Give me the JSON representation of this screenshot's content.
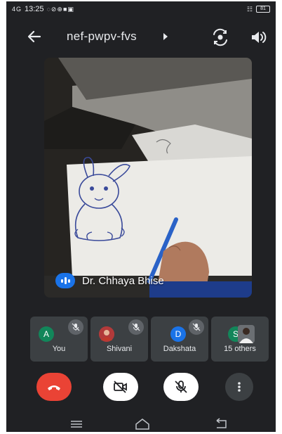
{
  "status_bar": {
    "network": "4G",
    "time": "13:25",
    "battery": "81"
  },
  "top_bar": {
    "meeting_code": "nef-pwpv-fvs"
  },
  "main_video": {
    "speaker_name": "Dr. Chhaya Bhise"
  },
  "participants": [
    {
      "label": "You",
      "initial": "A",
      "avatar_color": "#12865a",
      "muted": true
    },
    {
      "label": "Shivani",
      "initial": "",
      "avatar_color": "#b23a3a",
      "muted": true
    },
    {
      "label": "Dakshata",
      "initial": "D",
      "avatar_color": "#1a73e8",
      "muted": true
    },
    {
      "label": "15 others",
      "initial": "S",
      "avatar_color": "#12865a",
      "muted": false
    }
  ],
  "controls": {
    "end_call_color": "#ea4335",
    "buttons": [
      "end-call-icon",
      "video-off-icon",
      "mic-off-icon",
      "more-vert-icon"
    ]
  },
  "colors": {
    "background": "#202124",
    "tile": "#3c4043",
    "accent": "#1a73e8"
  }
}
